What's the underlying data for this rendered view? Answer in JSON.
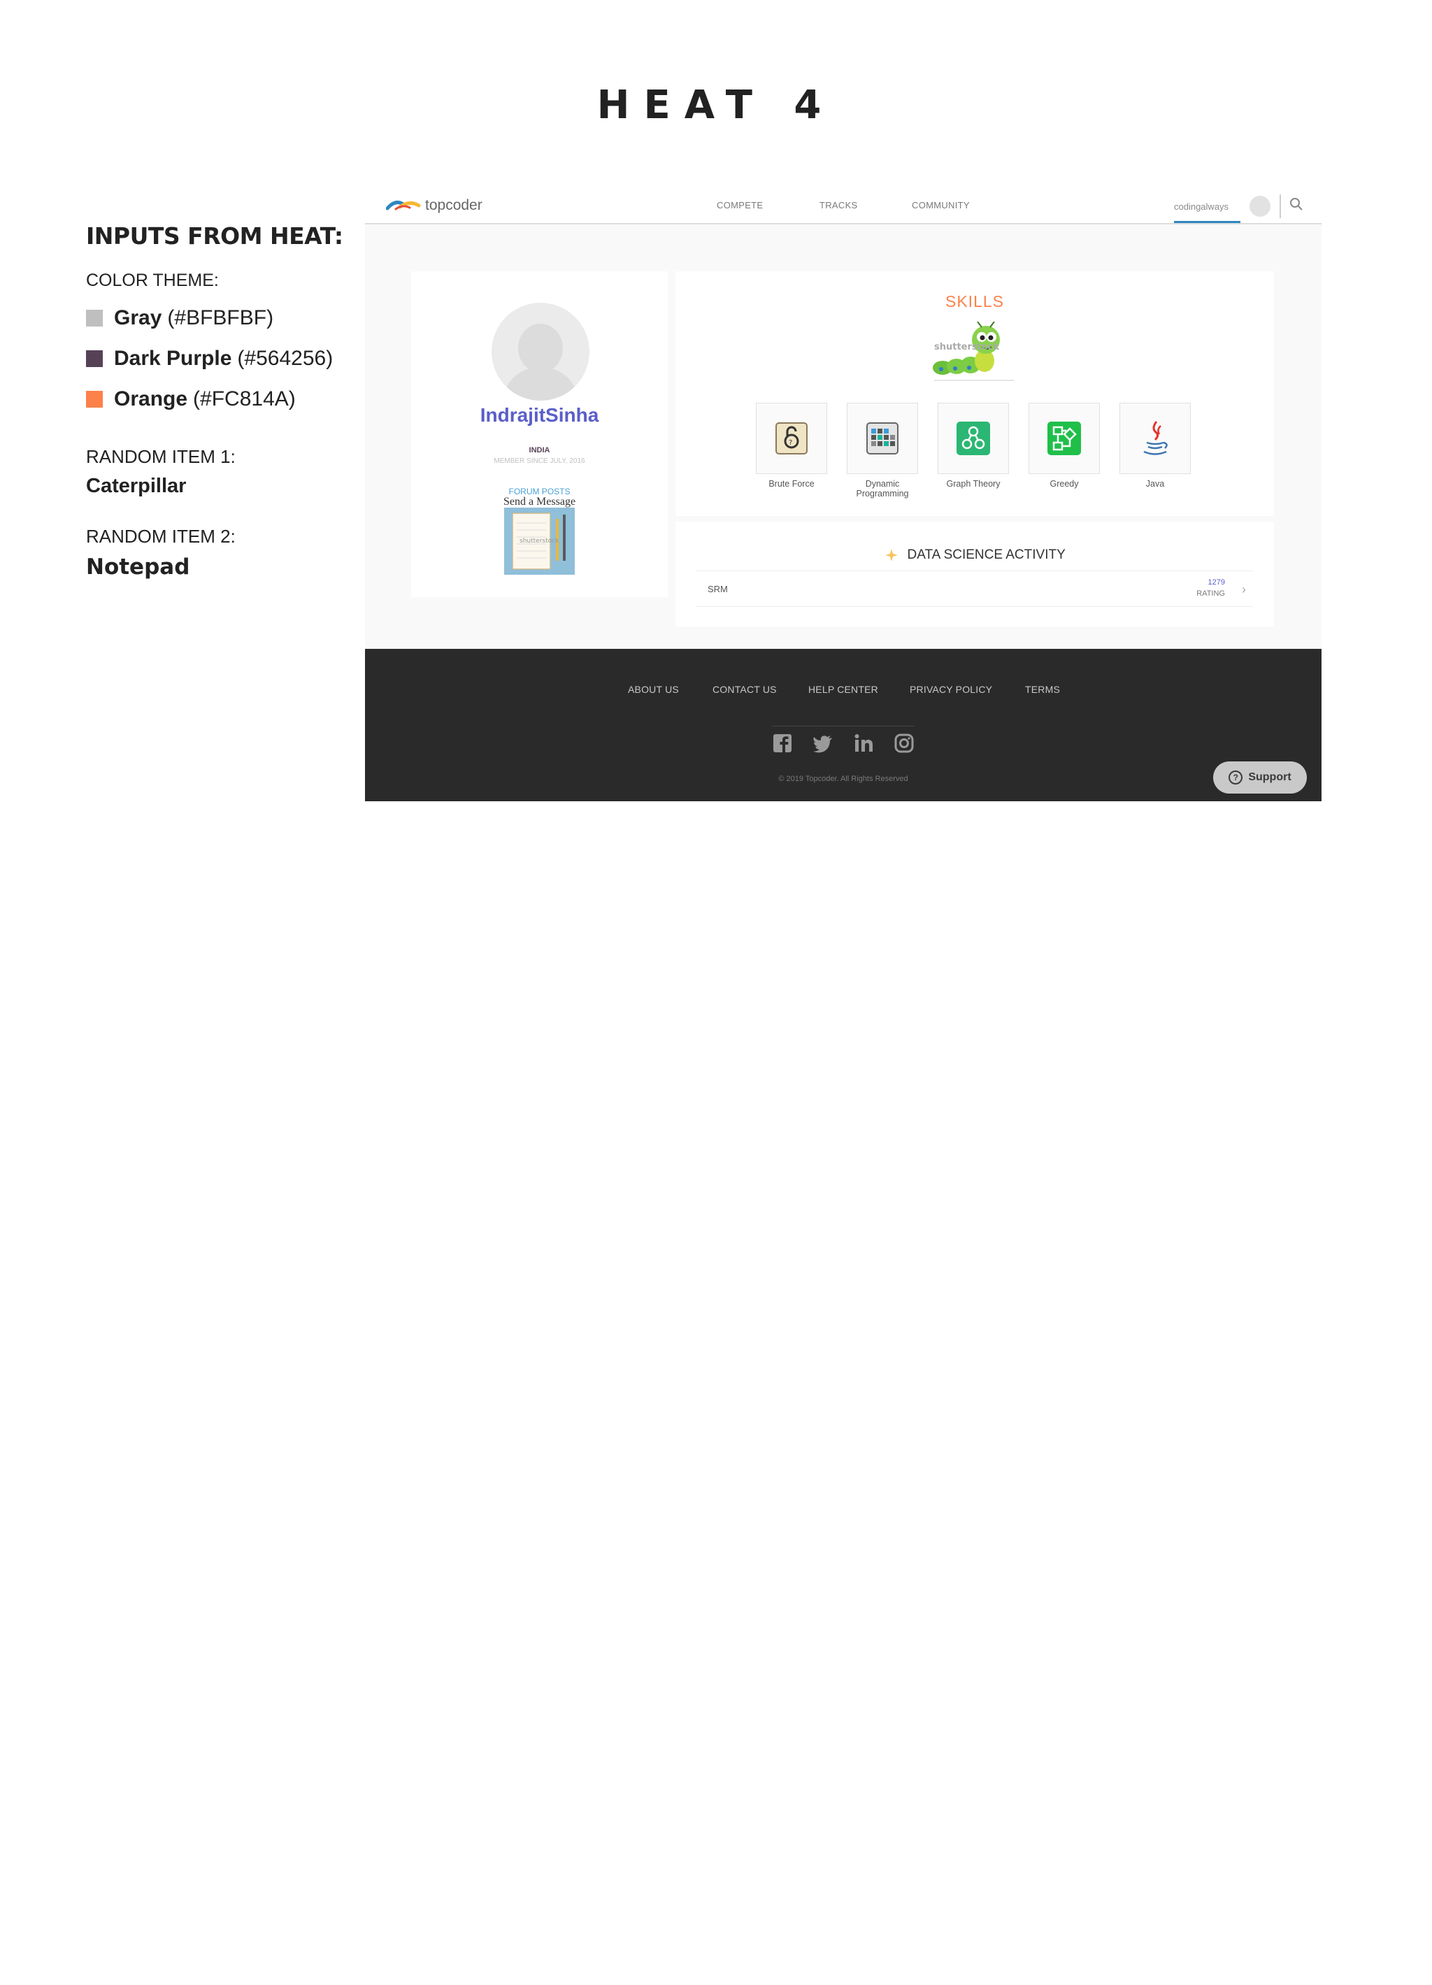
{
  "heat": {
    "title": "HEAT 4"
  },
  "inputs": {
    "heading": "INPUTS FROM HEAT:",
    "color_theme_label": "COLOR THEME:",
    "colors": [
      {
        "name": "Gray",
        "code": "(#BFBFBF)",
        "hex": "#BFBFBF"
      },
      {
        "name": "Dark Purple",
        "code": "(#564256)",
        "hex": "#564256"
      },
      {
        "name": "Orange",
        "code": "(#FC814A)",
        "hex": "#FC814A"
      }
    ],
    "random_item_1_label": "RANDOM ITEM 1:",
    "random_item_1": "Caterpillar",
    "random_item_2_label": "RANDOM ITEM 2:",
    "random_item_2": "Notepad"
  },
  "nav": {
    "logo": "topcoder",
    "links": [
      "COMPETE",
      "TRACKS",
      "COMMUNITY"
    ],
    "username": "codingalways"
  },
  "profile": {
    "handle": "IndrajitSinha",
    "country": "INDIA",
    "member_since": "MEMBER SINCE JULY, 2016",
    "forum_posts": "FORUM POSTS",
    "send_message": "Send a Message",
    "notepad_watermark": "shutterstock"
  },
  "skills": {
    "title": "SKILLS",
    "caterpillar_watermark": "shutterstock",
    "items": [
      {
        "label": "Brute Force",
        "icon": "lock-icon"
      },
      {
        "label": "Dynamic Programming",
        "icon": "grid-icon"
      },
      {
        "label": "Graph Theory",
        "icon": "graph-icon"
      },
      {
        "label": "Greedy",
        "icon": "flow-icon"
      },
      {
        "label": "Java",
        "icon": "java-icon"
      }
    ]
  },
  "data_science": {
    "title": "DATA SCIENCE ACTIVITY",
    "track": "SRM",
    "rating": "1279",
    "rating_label": "RATING"
  },
  "footer": {
    "links": [
      "ABOUT US",
      "CONTACT US",
      "HELP CENTER",
      "PRIVACY POLICY",
      "TERMS"
    ],
    "social": [
      "facebook-icon",
      "twitter-icon",
      "linkedin-icon",
      "instagram-icon"
    ],
    "copyright": "© 2019 Topcoder. All Rights Reserved",
    "support": "Support"
  }
}
